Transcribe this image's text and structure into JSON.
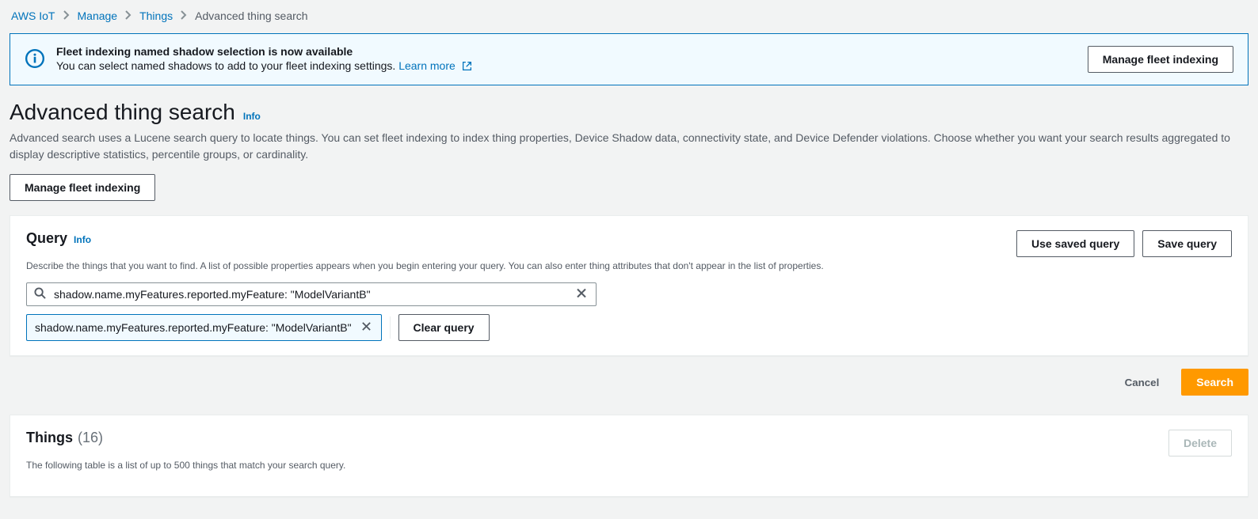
{
  "breadcrumb": {
    "items": [
      "AWS IoT",
      "Manage",
      "Things"
    ],
    "current": "Advanced thing search"
  },
  "banner": {
    "title": "Fleet indexing named shadow selection is now available",
    "body": "You can select named shadows to add to your fleet indexing settings.",
    "learn_more": "Learn more",
    "action": "Manage fleet indexing"
  },
  "page": {
    "title": "Advanced thing search",
    "info_label": "Info",
    "description": "Advanced search uses a Lucene search query to locate things. You can set fleet indexing to index thing properties, Device Shadow data, connectivity state, and Device Defender violations. Choose whether you want your search results aggregated to display descriptive statistics, percentile groups, or cardinality.",
    "manage_fleet_btn": "Manage fleet indexing"
  },
  "query_panel": {
    "title": "Query",
    "info_label": "Info",
    "description": "Describe the things that you want to find. A list of possible properties appears when you begin entering your query. You can also enter thing attributes that don't appear in the list of properties.",
    "use_saved_btn": "Use saved query",
    "save_query_btn": "Save query",
    "search_value": "shadow.name.myFeatures.reported.myFeature: \"ModelVariantB\"",
    "token_text": "shadow.name.myFeatures.reported.myFeature: \"ModelVariantB\"",
    "clear_query_btn": "Clear query"
  },
  "actions": {
    "cancel": "Cancel",
    "search": "Search"
  },
  "things_panel": {
    "title": "Things",
    "count_display": "(16)",
    "description": "The following table is a list of up to 500 things that match your search query.",
    "delete_btn": "Delete"
  }
}
